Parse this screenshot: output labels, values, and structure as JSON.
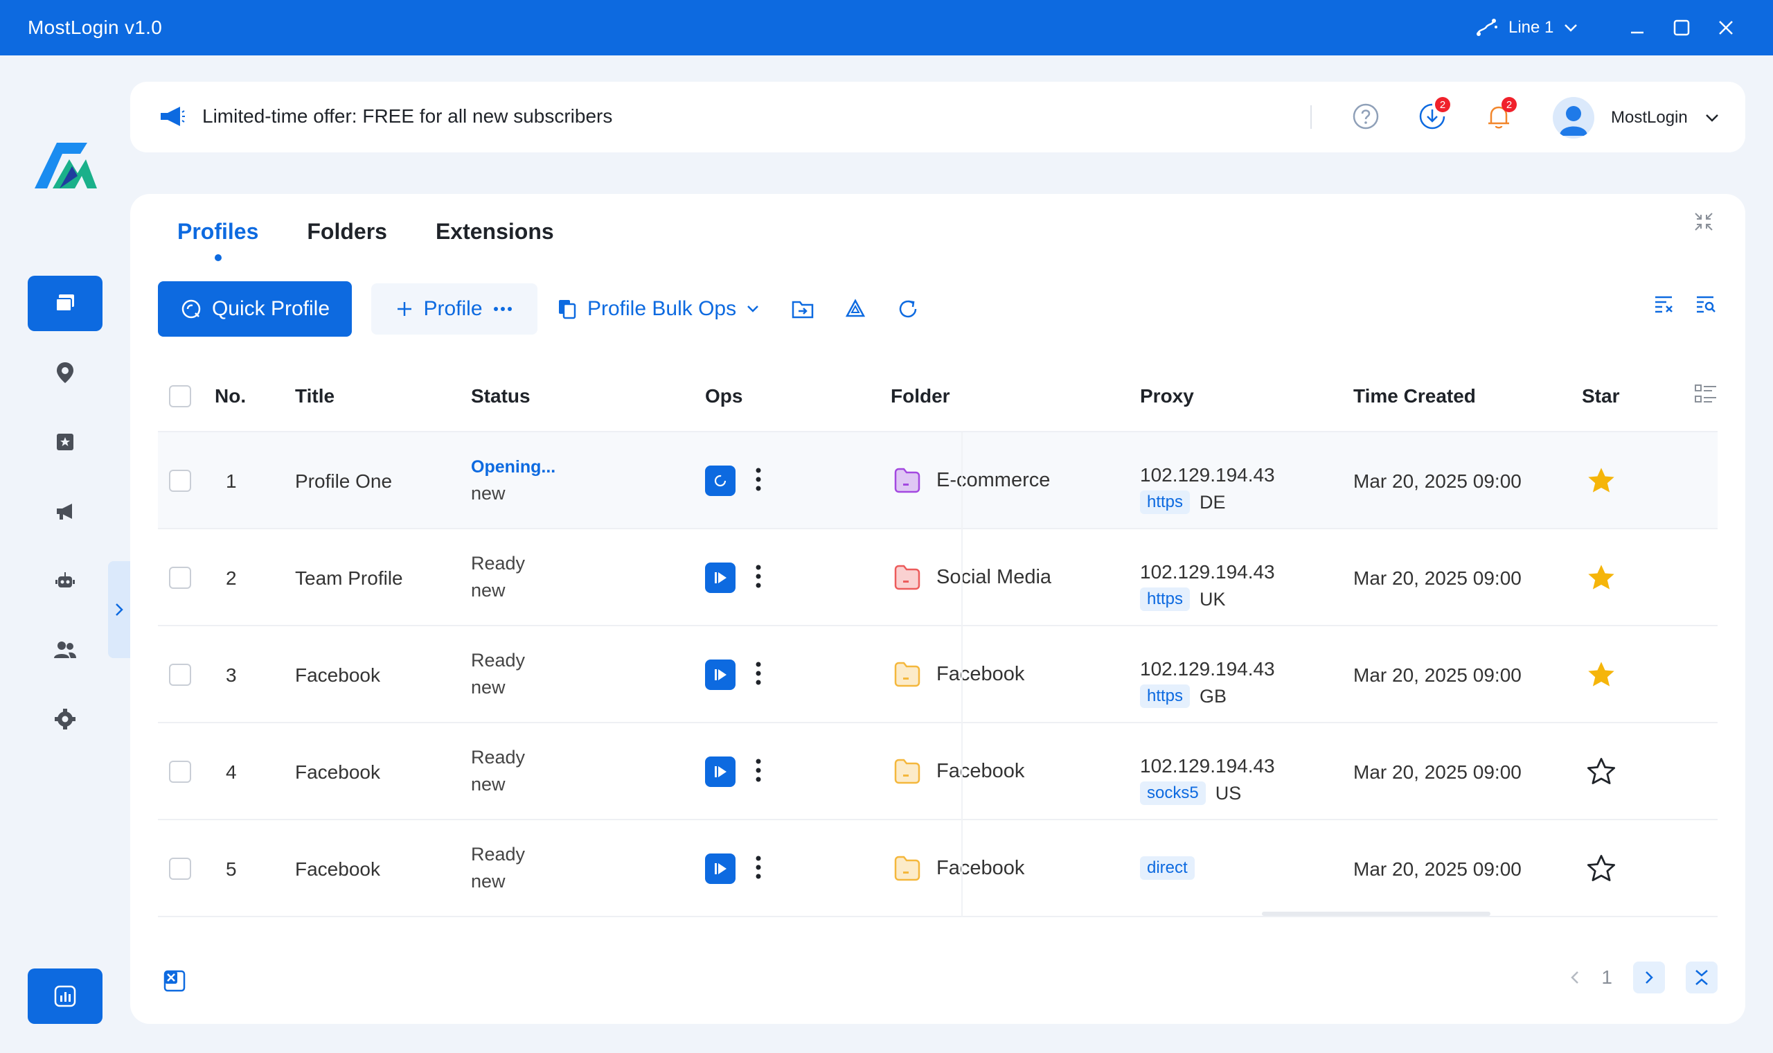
{
  "app": {
    "title": "MostLogin v1.0",
    "line_label": "Line 1"
  },
  "colors": {
    "primary": "#0d6ae0",
    "badge": "#f0212b",
    "star": "#f5b50a"
  },
  "banner": {
    "offer": "Limited-time offer: FREE for all new subscribers",
    "download_badge": "2",
    "notification_badge": "2",
    "user_name": "MostLogin"
  },
  "tabs": [
    {
      "label": "Profiles",
      "active": true
    },
    {
      "label": "Folders",
      "active": false
    },
    {
      "label": "Extensions",
      "active": false
    }
  ],
  "toolbar": {
    "quick_profile": "Quick Profile",
    "profile": "Profile",
    "bulk_ops": "Profile Bulk Ops"
  },
  "columns": {
    "no": "No.",
    "title": "Title",
    "status": "Status",
    "ops": "Ops",
    "folder": "Folder",
    "proxy": "Proxy",
    "time_created": "Time Created",
    "star": "Star"
  },
  "rows": [
    {
      "no": "1",
      "title": "Profile One",
      "status": "Opening...",
      "status2": "new",
      "folder": "E-commerce",
      "folder_color": "#a348e0",
      "proxy_ip": "102.129.194.43",
      "proxy_type": "https",
      "proxy_country": "DE",
      "time": "Mar 20, 2025 09:00",
      "starred": true
    },
    {
      "no": "2",
      "title": "Team Profile",
      "status": "Ready",
      "status2": "new",
      "folder": "Social Media",
      "folder_color": "#ec5b5b",
      "proxy_ip": "102.129.194.43",
      "proxy_type": "https",
      "proxy_country": "UK",
      "time": "Mar 20, 2025 09:00",
      "starred": true
    },
    {
      "no": "3",
      "title": "Facebook",
      "status": "Ready",
      "status2": "new",
      "folder": "Facebook",
      "folder_color": "#f4b73c",
      "proxy_ip": "102.129.194.43",
      "proxy_type": "https",
      "proxy_country": "GB",
      "time": "Mar 20, 2025 09:00",
      "starred": true
    },
    {
      "no": "4",
      "title": "Facebook",
      "status": "Ready",
      "status2": "new",
      "folder": "Facebook",
      "folder_color": "#f4b73c",
      "proxy_ip": "102.129.194.43",
      "proxy_type": "socks5",
      "proxy_country": "US",
      "time": "Mar 20, 2025 09:00",
      "starred": false
    },
    {
      "no": "5",
      "title": "Facebook",
      "status": "Ready",
      "status2": "new",
      "folder": "Facebook",
      "folder_color": "#f4b73c",
      "proxy_ip": "",
      "proxy_type": "direct",
      "proxy_country": "",
      "time": "Mar 20, 2025 09:00",
      "starred": false
    }
  ],
  "pagination": {
    "current_page": "1"
  },
  "icons": {
    "sidebar": [
      "profiles-icon",
      "location-icon",
      "bookmark-star-icon",
      "megaphone-icon",
      "robot-icon",
      "team-icon",
      "settings-icon"
    ],
    "bottom": "stats-icon"
  }
}
